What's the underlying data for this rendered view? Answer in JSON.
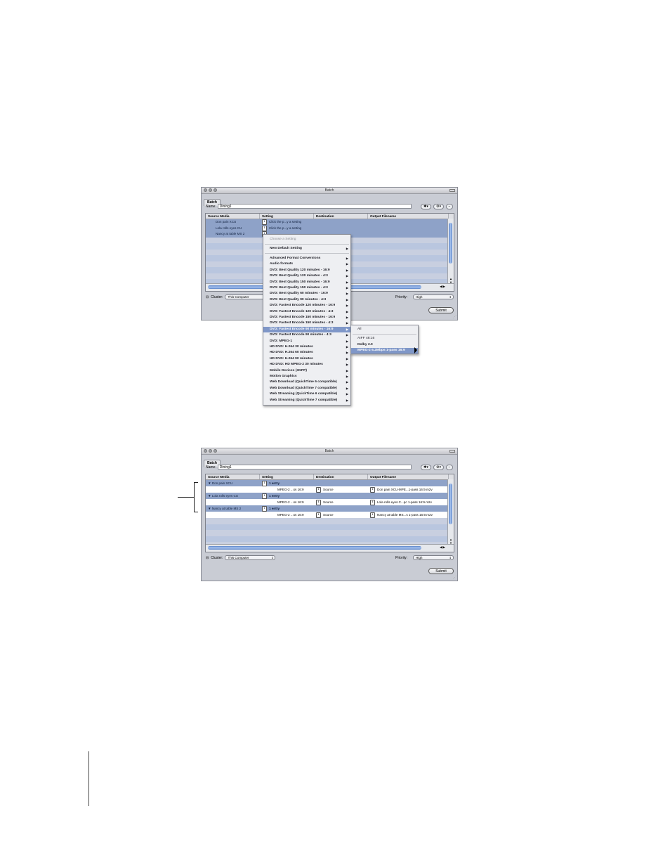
{
  "window1": {
    "title": "Batch",
    "tab": "Batch",
    "name_label": "Name:",
    "name_value": "Dining1",
    "columns": [
      "Source Media",
      "Setting",
      "Destination",
      "Output Filename"
    ],
    "rows": [
      {
        "source": "Don pain XCU",
        "setting": "Click the p...y a setting"
      },
      {
        "source": "Lola rolls eyes CU",
        "setting": "Click the p...y a setting"
      },
      {
        "source": "Nancy at table MS 2",
        "setting": ""
      }
    ],
    "cluster_label": "Cluster:",
    "cluster_value": "This Computer",
    "priority_label": "Priority:",
    "priority_value": "High",
    "submit": "Submit"
  },
  "menu": {
    "header": "Choose a Setting",
    "items": [
      "New Default Setting",
      "Advanced Format Conversions",
      "Audio formats",
      "DVD: Best Quality 120 minutes - 16:9",
      "DVD: Best Quality 120 minutes - 4:3",
      "DVD: Best Quality 150 minutes - 16:9",
      "DVD: Best Quality 150 minutes - 4:3",
      "DVD: Best Quality 60 minutes - 16:9",
      "DVD: Best Quality 90 minutes - 4:3",
      "DVD: Fastest Encode 120 minutes - 16:9",
      "DVD: Fastest Encode 120 minutes - 4:3",
      "DVD: Fastest Encode 150 minutes - 16:9",
      "DVD: Fastest Encode 150 minutes - 4:3",
      "DVD: Fastest Encode 90 minutes - 16:9",
      "DVD: Fastest Encode 90 minutes - 4:3",
      "DVD: MPEG-1",
      "HD DVD: H.264 30 minutes",
      "HD DVD: H.264 60 minutes",
      "HD DVD: H.264 90 minutes",
      "HD DVD: HD MPEG-2 30 minutes",
      "Mobile Devices (3GPP)",
      "Motion Graphics",
      "Web Download (QuickTime 6 compatible)",
      "Web Download (QuickTime 7 compatible)",
      "Web Streaming (QuickTime 6 compatible)",
      "Web Streaming (QuickTime 7 compatible)"
    ],
    "submenu": [
      "All",
      "AIFF 48:16",
      "Dolby 2.0",
      "MPEG-2 6.2Mbps 1-pass 16:9"
    ]
  },
  "window2": {
    "title": "Batch",
    "tab": "Batch",
    "name_label": "Name:",
    "name_value": "Dining1",
    "columns": [
      "Source Media",
      "Setting",
      "Destination",
      "Output Filename"
    ],
    "groups": [
      {
        "source": "Don pain XCU",
        "entry": "1 entry",
        "setting": "MPEG-2 ...ss 16:9",
        "destination": "Source",
        "output": "Don pain XCU-MPE...1-pass 16:9.m2v"
      },
      {
        "source": "Lola rolls eyes CU",
        "entry": "1 entry",
        "setting": "MPEG-2 ...ss 16:9",
        "destination": "Source",
        "output": "Lola rolls eyes C...pc 1-pass 16:9.m2v"
      },
      {
        "source": "Nancy at table MS 2",
        "entry": "1 entry",
        "setting": "MPEG-2 ...ss 16:9",
        "destination": "Source",
        "output": "Nancy at table MS...s 1-pass 16:9.m2v"
      }
    ],
    "cluster_label": "Cluster:",
    "cluster_value": "This Computer",
    "priority_label": "Priority:",
    "priority_value": "High",
    "submit": "Submit"
  }
}
